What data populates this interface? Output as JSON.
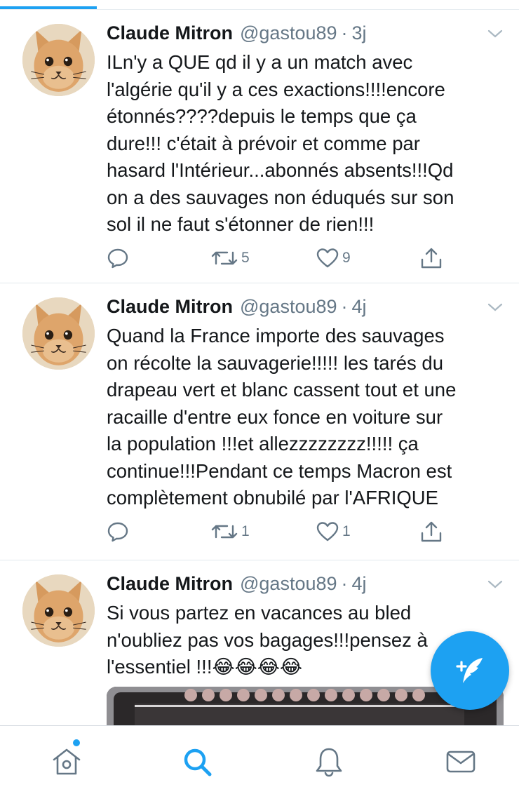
{
  "colors": {
    "accent": "#1da1f2",
    "muted": "#657786",
    "text": "#14171a",
    "divider": "#e1e8ed"
  },
  "tweets": [
    {
      "name": "Claude Mitron",
      "handle": "@gastou89",
      "separator": "·",
      "time": "3j",
      "text": "ILn'y a QUE qd il y a un match avec\nl'algérie qu'il y a ces exactions!!!!encore\nétonnés????depuis le temps que ça\ndure!!! c'était à prévoir et comme par\nhasard l'Intérieur...abonnés absents!!!Qd\non a des sauvages non éduqués sur son\nsol il ne faut s'étonner de rien!!!",
      "retweets": "5",
      "likes": "9",
      "avatar_icon": "cat-avatar-icon"
    },
    {
      "name": "Claude Mitron",
      "handle": "@gastou89",
      "separator": "·",
      "time": "4j",
      "text": "Quand la France importe des sauvages\non récolte la sauvagerie!!!!! les tarés du\ndrapeau vert et blanc cassent tout et une\nracaille d'entre eux fonce en voiture sur\nla population !!!et allezzzzzzzz!!!!! ça\ncontinue!!!Pendant ce temps Macron est\ncomplètement obnubilé par l'AFRIQUE",
      "retweets": "1",
      "likes": "1",
      "avatar_icon": "cat-avatar-icon"
    },
    {
      "name": "Claude Mitron",
      "handle": "@gastou89",
      "separator": "·",
      "time": "4j",
      "text": "Si vous partez en vacances au bled\nn'oubliez pas vos bagages!!!pensez à\nl'essentiel !!!😂😂😂😂",
      "avatar_icon": "cat-avatar-icon"
    }
  ],
  "fab": {
    "icon": "compose-tweet-icon"
  },
  "tabbar": {
    "items": [
      {
        "icon": "home-icon",
        "active": false,
        "has_badge": true
      },
      {
        "icon": "search-icon",
        "active": true
      },
      {
        "icon": "notifications-bell-icon",
        "active": false
      },
      {
        "icon": "messages-envelope-icon",
        "active": false
      }
    ]
  }
}
